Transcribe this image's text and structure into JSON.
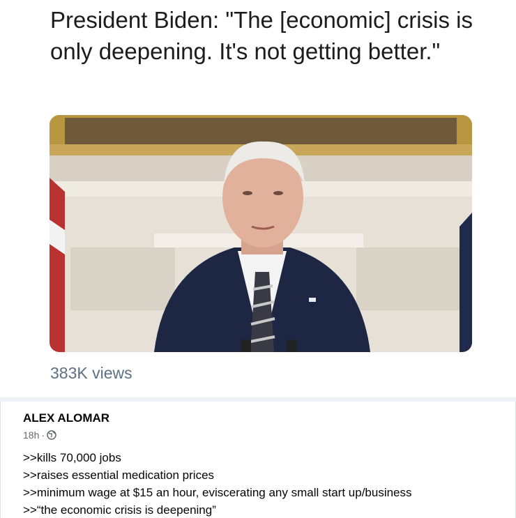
{
  "tweet": {
    "headline": "President Biden: \"The [economic] crisis is only deepening. It's not getting better.\"",
    "views": "383K views"
  },
  "post": {
    "author": "ALEX ALOMAR",
    "time": "18h",
    "separator": "·",
    "lines": [
      ">>kills 70,000 jobs",
      ">>raises essential medication prices",
      ">>minimum wage at $15 an hour, eviscerating any small start up/business",
      ">>“the economic crisis is deepening”"
    ]
  },
  "icons": {
    "privacy": "globe-icon"
  }
}
